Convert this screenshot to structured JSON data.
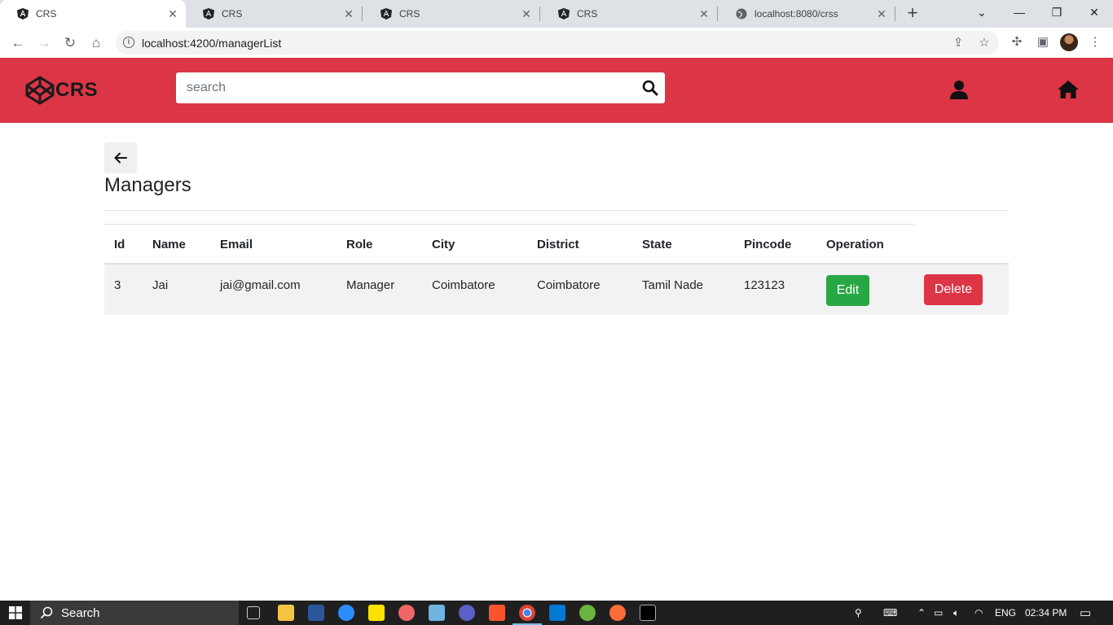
{
  "browser": {
    "tabs": [
      {
        "title": "CRS",
        "active": true
      },
      {
        "title": "CRS",
        "active": false
      },
      {
        "title": "CRS",
        "active": false
      },
      {
        "title": "CRS",
        "active": false
      },
      {
        "title": "localhost:8080/crss",
        "active": false
      }
    ],
    "url": "localhost:4200/managerList"
  },
  "header": {
    "logo_text": "CRS",
    "search_placeholder": "search"
  },
  "page": {
    "title": "Managers"
  },
  "table": {
    "columns": [
      "Id",
      "Name",
      "Email",
      "Role",
      "City",
      "District",
      "State",
      "Pincode",
      "Operation"
    ],
    "rows": [
      {
        "id": "3",
        "name": "Jai",
        "email": "jai@gmail.com",
        "role": "Manager",
        "city": "Coimbatore",
        "district": "Coimbatore",
        "state": "Tamil Nade",
        "pincode": "123123",
        "edit_label": "Edit",
        "delete_label": "Delete"
      }
    ]
  },
  "taskbar": {
    "search_label": "Search",
    "language": "ENG",
    "time": "02:34 PM"
  },
  "colors": {
    "header_bg": "#dc3545",
    "edit_btn": "#28a745",
    "delete_btn": "#dc3545"
  }
}
